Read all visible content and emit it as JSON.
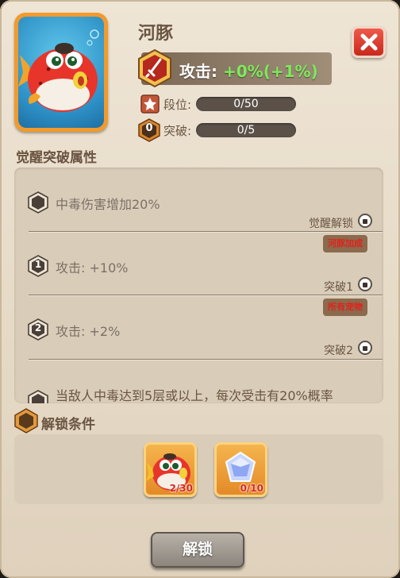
{
  "fish": {
    "name": "河豚",
    "attack_label": "攻击: ",
    "attack_value": "+0%",
    "attack_bonus": "(+1%)",
    "rank_label": "段位:",
    "rank_progress": "0/50",
    "rank_fraction": 0,
    "breakthrough_label": "突破:",
    "breakthrough_progress": "0/5",
    "breakthrough_fraction": 0,
    "breakthrough_level": "0"
  },
  "awaken": {
    "title": "觉醒突破属性",
    "items": [
      {
        "level": "",
        "text": "中毒伤害增加20%",
        "requirement": "觉醒解锁",
        "tag": "河豚加成"
      },
      {
        "level": "1",
        "text": "攻击: +10%",
        "requirement": "突破1",
        "tag": "所有宠物"
      },
      {
        "level": "2",
        "text": "攻击: +2%",
        "requirement": "突破2",
        "tag": ""
      },
      {
        "level": "",
        "text": "当敌人中毒达到5层或以上，每次受击有20%概率",
        "requirement": "",
        "tag": ""
      }
    ]
  },
  "unlock": {
    "title": "解锁条件",
    "items": [
      {
        "icon": "pufferfish-icon",
        "count": "2/30"
      },
      {
        "icon": "crystal-gem-icon",
        "count": "0/10"
      }
    ],
    "button_label": "解锁"
  },
  "colors": {
    "accent_green": "#7dea5a",
    "tag_red": "#e0231b",
    "close_red": "#d8352a"
  }
}
